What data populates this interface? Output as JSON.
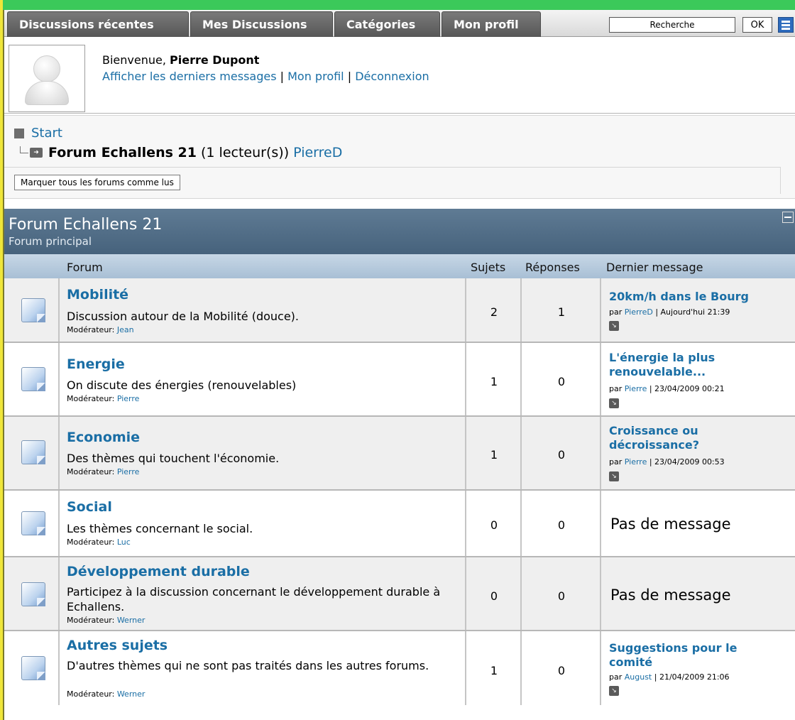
{
  "nav": {
    "tabs": [
      "Discussions récentes",
      "Mes Discussions",
      "Catégories",
      "Mon profil"
    ],
    "search_value": "Recherche",
    "ok_label": "OK"
  },
  "welcome": {
    "greeting": "Bienvenue, ",
    "user_name": "Pierre Dupont",
    "link_latest": "Afficher les derniers messages",
    "link_profile": "Mon profil",
    "link_logout": "Déconnexion",
    "separator": " | "
  },
  "breadcrumb": {
    "start": "Start",
    "forum_name": "Forum Echallens 21",
    "readers": "(1 lecteur(s))",
    "reader_user": "PierreD",
    "mark_all_read": "Marquer tous les forums comme lus"
  },
  "category": {
    "title": "Forum Echallens 21",
    "subtitle": "Forum principal"
  },
  "columns": {
    "forum": "Forum",
    "topics": "Sujets",
    "replies": "Réponses",
    "last_message": "Dernier message"
  },
  "labels": {
    "moderator": "Modérateur:",
    "by": "par",
    "no_message": "Pas de message"
  },
  "forums": [
    {
      "name": "Mobilité",
      "description": "Discussion autour de la Mobilité (douce).",
      "moderator": "Jean",
      "topics": "2",
      "replies": "1",
      "last_title": "20km/h dans le Bourg",
      "last_author": "PierreD",
      "last_date": " | Aujourd'hui 21:39"
    },
    {
      "name": "Energie",
      "description": "On discute des énergies (renouvelables)",
      "moderator": "Pierre",
      "topics": "1",
      "replies": "0",
      "last_title": "L'énergie la plus renouvelable...",
      "last_author": "Pierre",
      "last_date": " | 23/04/2009 00:21"
    },
    {
      "name": "Economie",
      "description": "Des thèmes qui touchent l'économie.",
      "moderator": "Pierre",
      "topics": "1",
      "replies": "0",
      "last_title": "Croissance ou décroissance?",
      "last_author": "Pierre",
      "last_date": " | 23/04/2009 00:53"
    },
    {
      "name": "Social",
      "description": "Les thèmes concernant le social.",
      "moderator": "Luc",
      "topics": "0",
      "replies": "0"
    },
    {
      "name": "Développement durable",
      "description": "Participez à la discussion concernant le développement durable à Echallens.",
      "moderator": "Werner",
      "topics": "0",
      "replies": "0"
    },
    {
      "name": "Autres sujets",
      "description": "D'autres thèmes qui ne sont pas traités dans les autres forums.",
      "moderator": "Werner",
      "topics": "1",
      "replies": "0",
      "last_title": "Suggestions pour le comité",
      "last_author": "August",
      "last_date": " | 21/04/2009 21:06"
    }
  ],
  "colors": {
    "link": "#1a6ea5",
    "tab_bg": "#5f5f5f",
    "category_header": "#52708a",
    "column_header": "#b8cde0"
  }
}
